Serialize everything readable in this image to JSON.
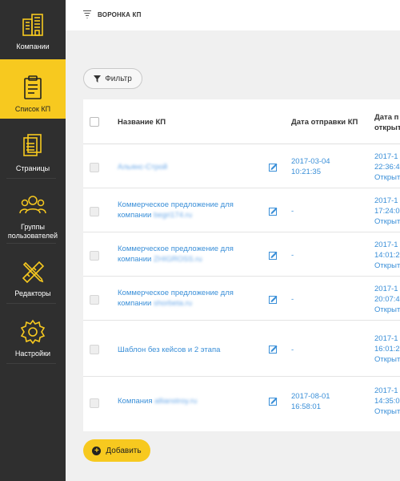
{
  "sidebar": {
    "items": [
      {
        "label": "Компании",
        "icon": "buildings-icon"
      },
      {
        "label": "Список КП",
        "icon": "clipboard-icon"
      },
      {
        "label": "Страницы",
        "icon": "pages-icon"
      },
      {
        "label": "Группы\nпользователей",
        "icon": "users-group-icon"
      },
      {
        "label": "Редакторы",
        "icon": "ruler-pencil-icon"
      },
      {
        "label": "Настройки",
        "icon": "gear-icon"
      }
    ]
  },
  "topbar": {
    "title": "ВОРОНКА КП"
  },
  "filter": {
    "label": "Фильтр"
  },
  "table": {
    "headers": {
      "name": "Название КП",
      "sent": "Дата отправки КП",
      "opened_line1": "Дата п",
      "opened_line2": "открыт"
    },
    "rows": [
      {
        "name_plain": "",
        "name_blurred": "Альянс-Строй",
        "sent1": "2017-03-04",
        "sent2": "10:21:35",
        "op1": "2017-1",
        "op2": "22:36:4",
        "op3": "Открыт"
      },
      {
        "name_plain": "Коммерческое предложение для компании",
        "name_blurred": "begri174.ru",
        "sent1": "-",
        "sent2": "",
        "op1": "2017-1",
        "op2": "17:24:0",
        "op3": "Открыт"
      },
      {
        "name_plain": "Коммерческое предложение для компании",
        "name_blurred": "ZHIGROSS.ru",
        "sent1": "-",
        "sent2": "",
        "op1": "2017-1",
        "op2": "14:01:2",
        "op3": "Открыт"
      },
      {
        "name_plain": "Коммерческое предложение для компании",
        "name_blurred": "shorbeta.ru",
        "sent1": "-",
        "sent2": "",
        "op1": "2017-1",
        "op2": "20:07:4",
        "op3": "Открыт"
      },
      {
        "name_plain": "Шаблон без кейсов и 2 этапа",
        "name_blurred": "",
        "sent1": "-",
        "sent2": "",
        "op1": "2017-1",
        "op2": "16:01:2",
        "op3": "Открыт"
      },
      {
        "name_plain": "Компания",
        "name_blurred": "allianstroy.ru",
        "sent1": "2017-08-01",
        "sent2": "16:58:01",
        "op1": "2017-1",
        "op2": "14:35:0",
        "op3": "Открыт"
      }
    ]
  },
  "add": {
    "label": "Добавить"
  },
  "colors": {
    "accent": "#f7c91f",
    "sidebar": "#2f2f2f",
    "link": "#3a8fd8"
  }
}
